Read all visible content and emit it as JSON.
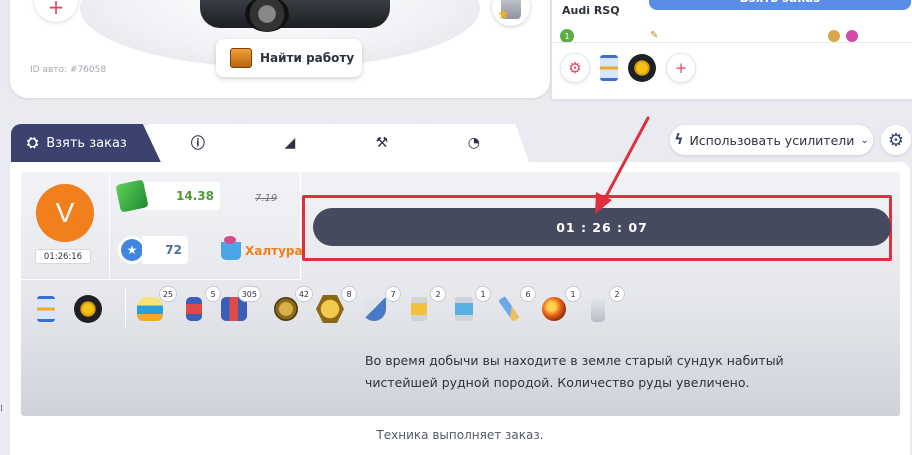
{
  "car_panel": {
    "id_text": "ID авто: #76058",
    "find_work_label": "Найти работу"
  },
  "right_panel": {
    "car_name": "Audi RSQ",
    "take_order_label": "Взять заказ",
    "level": "1"
  },
  "tabs": [
    {
      "label": "Взять заказ",
      "icon": "engine-icon",
      "active": true
    },
    {
      "label": "",
      "icon": "info-icon",
      "active": false
    },
    {
      "label": "",
      "icon": "muscle-icon",
      "active": false
    },
    {
      "label": "",
      "icon": "tools-icon",
      "active": false
    },
    {
      "label": "",
      "icon": "speedometer-icon",
      "active": false
    }
  ],
  "tab_glyphs": {
    "engine": "⛭",
    "info": "ⓘ",
    "muscle": "◢",
    "tools": "⚒",
    "speedometer": "◔"
  },
  "use_boost_label": "Использовать усилители",
  "player": {
    "avatar_letter": "V",
    "avatar_timer": "01:26:16",
    "money": "14.38",
    "money_old": "7.19",
    "xp": "72",
    "bonus_label": "Халтура"
  },
  "timer": "01 : 26 : 07",
  "items": [
    {
      "name": "hourglass",
      "count": ""
    },
    {
      "name": "gold-tire",
      "count": ""
    },
    {
      "name": "cake",
      "count": "25"
    },
    {
      "name": "jar",
      "count": "5"
    },
    {
      "name": "jars",
      "count": "305"
    },
    {
      "name": "medal",
      "count": "42"
    },
    {
      "name": "hex-coin",
      "count": "8"
    },
    {
      "name": "whistle",
      "count": "7"
    },
    {
      "name": "yellow-cup",
      "count": "2"
    },
    {
      "name": "blue-cup",
      "count": "1"
    },
    {
      "name": "pencil",
      "count": "6"
    },
    {
      "name": "orb",
      "count": "1"
    },
    {
      "name": "bottle",
      "count": "2"
    }
  ],
  "message_line1": "Во время добычи вы находите в земле старый сундук набитый",
  "message_line2": "чистейшей рудной породой. Количество руды увеличено.",
  "status": "Техника выполняет заказ.",
  "colors": {
    "accent_dark": "#3b4270",
    "timer_bg": "#454a5e",
    "highlight_red": "#e0303e",
    "avatar_orange": "#f07f1c",
    "button_blue": "#5b8de8"
  }
}
